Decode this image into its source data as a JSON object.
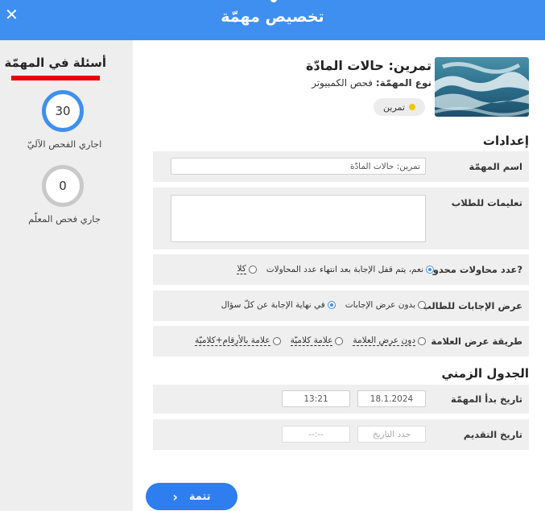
{
  "header": {
    "title": "تخصيص مهمّة",
    "close_icon": "✕"
  },
  "sidebar": {
    "title": "أسئلة في المهمّة",
    "auto_count": "30",
    "auto_label": "اجاري الفحص الآليّ",
    "teacher_count": "0",
    "teacher_label": "جاري فحص المعلّم"
  },
  "task": {
    "title": "تمرين: حالات المادّة",
    "type_label": "نوع المهمّة:",
    "type_value": "فحص الكمبيوتر",
    "badge": "تمرين",
    "badge_color": "#f5c400"
  },
  "settings": {
    "title": "إعدادات",
    "name_label": "اسم المهمّة",
    "name_value": "تمرين: حالات المادّة",
    "instructions_label": "تعليمات للطلاب",
    "instructions_value": "",
    "attempts_label": "عدد محاولات محدود?",
    "attempts_yes": "نعم، يتم قفل الإجابة بعد انتهاء عدد المحاولات",
    "attempts_no": "كلا",
    "answers_label": "عرض الإجابات للطالب",
    "answers_none": "بدون عرض الإجابات",
    "answers_end": "في نهاية الإجابة عن كلّ سؤال",
    "grade_label": "طريقة عرض العلامة",
    "grade_none": "دون عرض العلامة",
    "grade_words": "علامة كلاميّة",
    "grade_both": "علامة بالأرقام+كلاميّة"
  },
  "schedule": {
    "title": "الجدول الزمني",
    "start_label": "تاريخ بدأ المهمّة",
    "start_date": "18.1.2024",
    "start_time": "13:21",
    "submit_label": "تاريخ التقديم",
    "submit_date_placeholder": "حدد التاريخ",
    "submit_time_placeholder": "--:--"
  },
  "footer": {
    "finish_label": "تتمة",
    "chevron_icon": "‹"
  },
  "colors": {
    "header": "#3f8ff0",
    "accent": "#2f7ef0",
    "underline": "#e60000"
  }
}
